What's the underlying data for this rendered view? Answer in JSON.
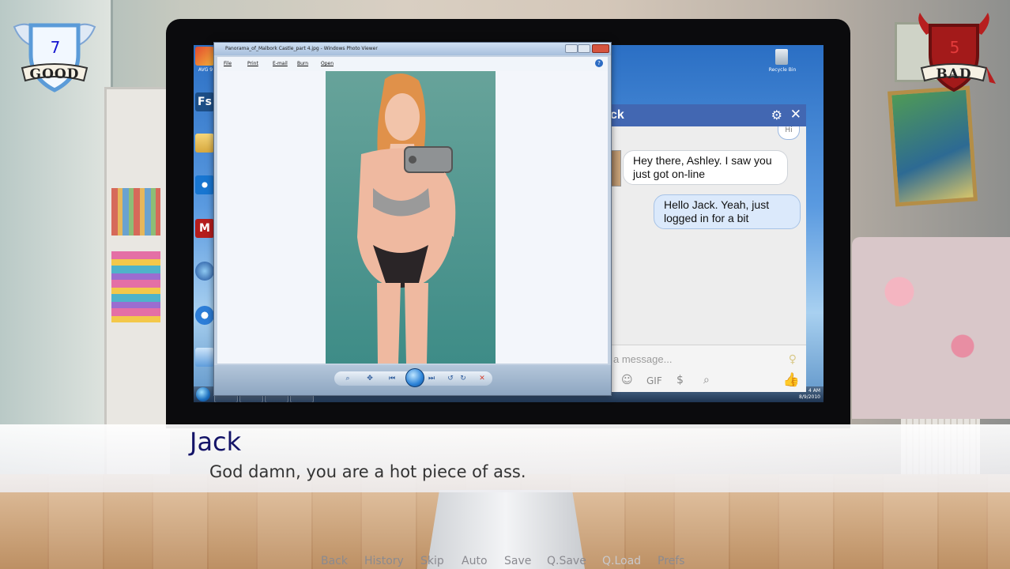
{
  "scores": {
    "good": {
      "value": "7",
      "label": "GOOD",
      "color": "#1616d0"
    },
    "bad": {
      "value": "5",
      "label": "BAD",
      "color": "#e43b3b"
    }
  },
  "desktop": {
    "recycle_bin": "Recycle Bin",
    "icons": [
      "AVG 9",
      "Fs",
      "",
      "",
      "M",
      "",
      "",
      ""
    ],
    "clock": {
      "time": "4 AM",
      "date": "8/9/2010"
    }
  },
  "photo_viewer": {
    "title": "Panorama_of_Malbork Castle_part 4.jpg - Windows Photo Viewer",
    "menu": [
      "File",
      "Print",
      "E-mail",
      "Burn",
      "Open"
    ]
  },
  "chat": {
    "contact_name": "ck",
    "greeting": "Hi",
    "messages": [
      {
        "from": "Jack",
        "text": "Hey there, Ashley. I saw you just got on-line"
      },
      {
        "from": "Ashley",
        "text": "Hello Jack. Yeah, just logged in for a bit"
      }
    ],
    "input_placeholder": "a message...",
    "gif_label": "GIF"
  },
  "dialogue": {
    "speaker": "Jack",
    "line": "God damn, you are a hot piece of ass."
  },
  "quick_menu": [
    {
      "label": "Back",
      "enabled": true
    },
    {
      "label": "History",
      "enabled": true
    },
    {
      "label": "Skip",
      "enabled": true
    },
    {
      "label": "Auto",
      "enabled": true
    },
    {
      "label": "Save",
      "enabled": true
    },
    {
      "label": "Q.Save",
      "enabled": true
    },
    {
      "label": "Q.Load",
      "enabled": false
    },
    {
      "label": "Prefs",
      "enabled": true
    }
  ]
}
